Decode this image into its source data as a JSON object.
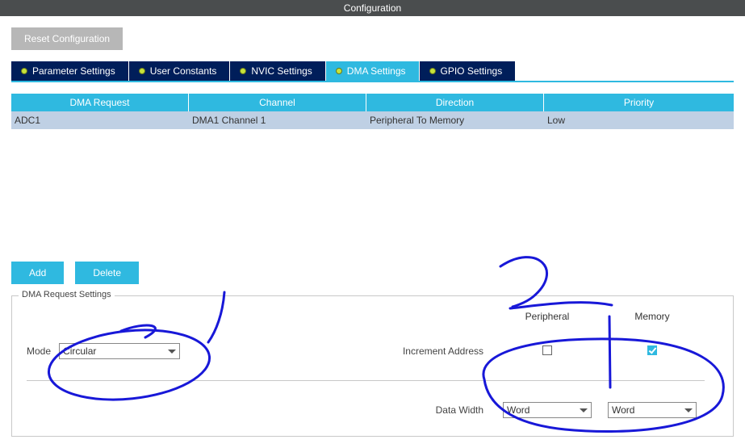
{
  "window": {
    "title": "Configuration"
  },
  "buttons": {
    "reset": "Reset Configuration",
    "add": "Add",
    "delete": "Delete"
  },
  "tabs": [
    {
      "label": "Parameter Settings",
      "active": false
    },
    {
      "label": "User Constants",
      "active": false
    },
    {
      "label": "NVIC Settings",
      "active": false
    },
    {
      "label": "DMA Settings",
      "active": true
    },
    {
      "label": "GPIO Settings",
      "active": false
    }
  ],
  "table": {
    "headers": [
      "DMA Request",
      "Channel",
      "Direction",
      "Priority"
    ],
    "rows": [
      {
        "request": "ADC1",
        "channel": "DMA1 Channel 1",
        "direction": "Peripheral To Memory",
        "priority": "Low"
      }
    ]
  },
  "settings": {
    "legend": "DMA Request Settings",
    "mode_label": "Mode",
    "mode_value": "Circular",
    "col_peripheral": "Peripheral",
    "col_memory": "Memory",
    "increment_label": "Increment Address",
    "increment_peripheral": false,
    "increment_memory": true,
    "datawidth_label": "Data Width",
    "datawidth_peripheral": "Word",
    "datawidth_memory": "Word"
  }
}
